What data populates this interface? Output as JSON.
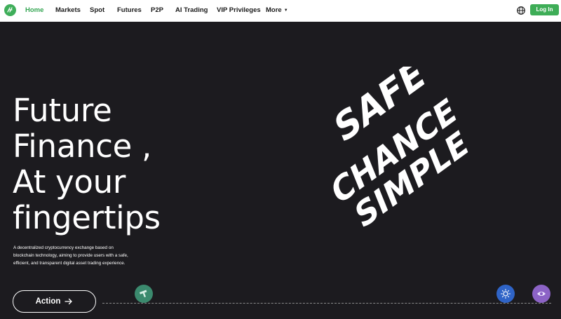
{
  "nav": {
    "items": [
      {
        "label": "Home",
        "active": true
      },
      {
        "label": "Markets"
      },
      {
        "label": "Spot"
      },
      {
        "label": "Futures"
      },
      {
        "label": "P2P"
      },
      {
        "label": "AI Trading"
      },
      {
        "label": "VIP Privileges"
      },
      {
        "label": "More"
      }
    ],
    "login_label": "Log In"
  },
  "hero": {
    "title_lines": [
      "Future",
      "Finance ,",
      "At your",
      "fingertips"
    ],
    "description": "A decentralized cryptocurrency exchange based on blockchain technology, aiming to provide users with a safe, efficient, and transparent digital asset trading experience.",
    "action_label": "Action"
  },
  "brand_words": [
    "SAFE",
    "CHANCE",
    "SIMPLE"
  ],
  "colors": {
    "accent": "#3ead57",
    "background": "#1c1b1f",
    "nav_background": "#ffffff"
  },
  "icons": {
    "logo": "exchange-logo-icon",
    "globe": "globe-icon",
    "coins": [
      "green-token-icon",
      "blue-token-icon",
      "purple-token-icon"
    ]
  }
}
